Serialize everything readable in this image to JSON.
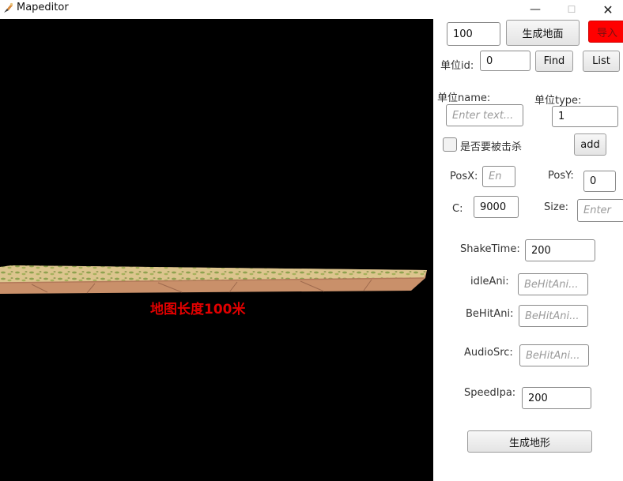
{
  "window": {
    "title": "Mapeditor",
    "controls": {
      "minimize": "—",
      "maximize": "☐",
      "close": "✕"
    }
  },
  "canvas": {
    "caption": "地图长度100米",
    "caption_color": "#e00000",
    "background": "#000000"
  },
  "panel": {
    "length_input": {
      "value": "100"
    },
    "generate_ground_button": "生成地面",
    "import_button": "导入",
    "unit_id": {
      "label": "单位id:",
      "value": "0"
    },
    "find_button": "Find",
    "list_button": "List",
    "unit_name": {
      "label": "单位name:",
      "placeholder": "Enter text..."
    },
    "unit_type": {
      "label": "单位type:",
      "value": "1"
    },
    "killable_checkbox": {
      "label": "是否要被击杀",
      "checked": false
    },
    "add_button": "add",
    "pos_x": {
      "label": "PosX:",
      "placeholder": "En"
    },
    "pos_y": {
      "label": "PosY:",
      "value": "0"
    },
    "c_field": {
      "label": "C:",
      "value": "9000"
    },
    "size_field": {
      "label": "Size:",
      "placeholder": "Enter"
    },
    "shake_time": {
      "label": "ShakeTime:",
      "value": "200"
    },
    "idle_ani": {
      "label": "idleAni:",
      "placeholder": "BeHitAni..."
    },
    "behit_ani": {
      "label": "BeHitAni:",
      "placeholder": "BeHitAni..."
    },
    "audio_src": {
      "label": "AudioSrc:",
      "placeholder": "BeHitAni..."
    },
    "speed_ipa": {
      "label": "SpeedIpa:",
      "value": "200"
    },
    "generate_terrain_button": "生成地形"
  }
}
